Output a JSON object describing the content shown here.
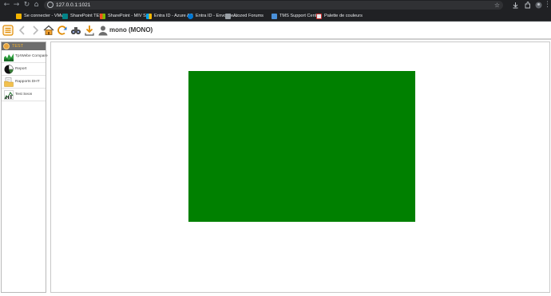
{
  "browser": {
    "url": "127.0.0.1:1021",
    "bookmarks": [
      {
        "label": "Se connecter - VMw..."
      },
      {
        "label": "SharePoint TEST"
      },
      {
        "label": "SharePoint - MIV S..."
      },
      {
        "label": "Entra ID - Azure AD"
      },
      {
        "label": "Entra ID - Envoi de..."
      },
      {
        "label": "Atozed Forums"
      },
      {
        "label": "TMS Support Center"
      },
      {
        "label": "Palette de couleurs"
      }
    ]
  },
  "toolbar": {
    "user_label": "mono (MONO)"
  },
  "sidebar": {
    "header": "TEST",
    "items": [
      {
        "label": "TprWebe Compare"
      },
      {
        "label": "Report"
      },
      {
        "label": "Rapports DHT"
      },
      {
        "label": "Test Seon"
      }
    ]
  },
  "main": {
    "panel_color": "#008000"
  }
}
